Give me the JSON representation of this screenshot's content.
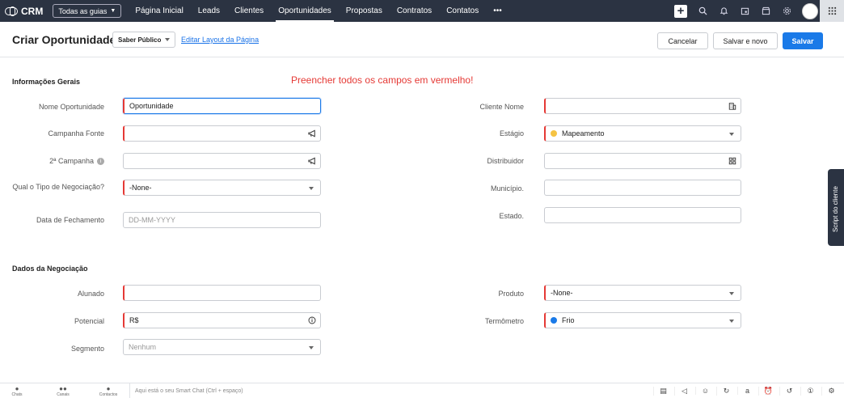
{
  "topbar": {
    "brand": "CRM",
    "guides_label": "Todas as guias",
    "nav": [
      "Página Inicial",
      "Leads",
      "Clientes",
      "Oportunidades",
      "Propostas",
      "Contratos",
      "Contatos",
      "•••"
    ],
    "active_nav": "Oportunidades"
  },
  "header": {
    "title": "Criar Oportunidade",
    "layout_value": "Saber Público",
    "edit_layout_link": "Editar Layout da Página",
    "cancel_label": "Cancelar",
    "save_new_label": "Salvar e novo",
    "save_label": "Salvar"
  },
  "warning": "Preencher todos os campos em vermelho!",
  "sections": {
    "general": "Informações Gerais",
    "deal": "Dados da Negociação"
  },
  "fields": {
    "nome_oportunidade": {
      "label": "Nome Oportunidade",
      "value": "Oportunidade"
    },
    "campanha_fonte": {
      "label": "Campanha Fonte",
      "value": ""
    },
    "segunda_campanha": {
      "label": "2ª Campanha",
      "value": ""
    },
    "tipo_negociacao": {
      "label": "Qual o Tipo de Negociação?",
      "value": "-None-"
    },
    "data_fechamento": {
      "label": "Data de Fechamento",
      "placeholder": "DD-MM-YYYY"
    },
    "cliente_nome": {
      "label": "Cliente Nome",
      "value": ""
    },
    "estagio": {
      "label": "Estágio",
      "value": "Mapeamento"
    },
    "distribuidor": {
      "label": "Distribuidor",
      "value": ""
    },
    "municipio": {
      "label": "Município.",
      "value": ""
    },
    "estado": {
      "label": "Estado.",
      "value": ""
    },
    "alunado": {
      "label": "Alunado",
      "value": ""
    },
    "potencial": {
      "label": "Potencial",
      "value": "R$"
    },
    "segmento": {
      "label": "Segmento",
      "placeholder": "Nenhum"
    },
    "produto": {
      "label": "Produto",
      "value": "-None-"
    },
    "termometro": {
      "label": "Termômetro",
      "value": "Frio"
    }
  },
  "colors": {
    "required": "#e53935",
    "estagio_dot": "#f5c343",
    "termometro_dot": "#1a7ae8",
    "primary": "#1a7ae8",
    "topbar": "#2b3342"
  },
  "script_tab": "Script do cliente",
  "bottombar": {
    "items": [
      "Chats",
      "Canais",
      "Contactos"
    ],
    "smartchat_placeholder": "Aqui está o seu Smart Chat (Ctrl + espaço)"
  }
}
